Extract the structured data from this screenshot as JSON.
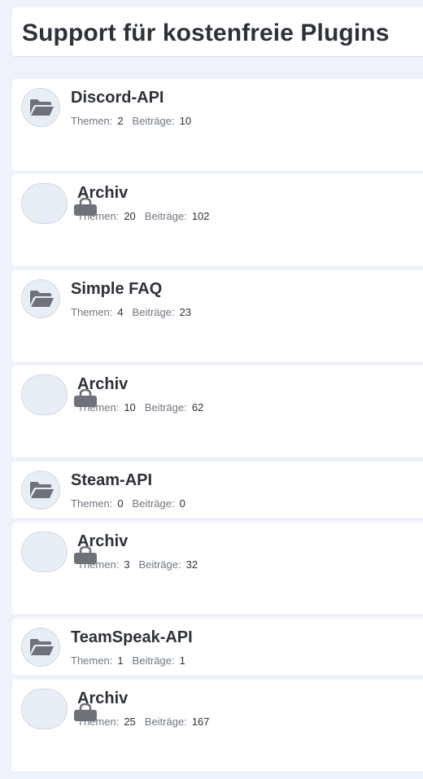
{
  "page": {
    "title": "Support für kostenfreie Plugins"
  },
  "forums": [
    {
      "name": "Discord-API",
      "icon": "folder-icon",
      "archived": false,
      "topics_label": "Themen:",
      "topics": "2",
      "posts_label": "Beiträge:",
      "posts": "10"
    },
    {
      "name": "Archiv",
      "icon": "lock-icon",
      "archived": true,
      "topics_label": "Themen:",
      "topics": "20",
      "posts_label": "Beiträge:",
      "posts": "102"
    },
    {
      "name": "Simple FAQ",
      "icon": "folder-icon",
      "archived": false,
      "topics_label": "Themen:",
      "topics": "4",
      "posts_label": "Beiträge:",
      "posts": "23"
    },
    {
      "name": "Archiv",
      "icon": "lock-icon",
      "archived": true,
      "topics_label": "Themen:",
      "topics": "10",
      "posts_label": "Beiträge:",
      "posts": "62"
    },
    {
      "name": "Steam-API",
      "icon": "folder-icon",
      "archived": false,
      "topics_label": "Themen:",
      "topics": "0",
      "posts_label": "Beiträge:",
      "posts": "0"
    },
    {
      "name": "Archiv",
      "icon": "lock-icon",
      "archived": true,
      "topics_label": "Themen:",
      "topics": "3",
      "posts_label": "Beiträge:",
      "posts": "32"
    },
    {
      "name": "TeamSpeak-API",
      "icon": "folder-icon",
      "archived": false,
      "topics_label": "Themen:",
      "topics": "1",
      "posts_label": "Beiträge:",
      "posts": "1"
    },
    {
      "name": "Archiv",
      "icon": "lock-icon",
      "archived": true,
      "topics_label": "Themen:",
      "topics": "25",
      "posts_label": "Beiträge:",
      "posts": "167"
    }
  ],
  "colors": {
    "page_background": "#eef3fb",
    "card_background": "#ffffff",
    "icon_circle": "#e8eef6",
    "icon_glyph": "#6e7177",
    "text": "#2d3138",
    "muted_text": "#6e7782"
  }
}
